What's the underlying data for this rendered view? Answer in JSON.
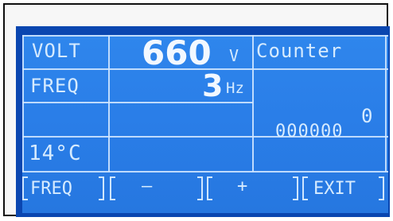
{
  "display": {
    "voltage_label": "VOLT",
    "voltage_value": "660",
    "voltage_unit": "V",
    "counter_label": "Counter",
    "frequency_label": "FREQ",
    "frequency_value": "3",
    "frequency_unit": "Hz",
    "counter_value": "0",
    "counter_digits": "000000",
    "temperature": "14°C"
  },
  "softkeys": {
    "freq": "FREQ",
    "minus": "—",
    "plus": "+",
    "exit": "EXIT"
  }
}
